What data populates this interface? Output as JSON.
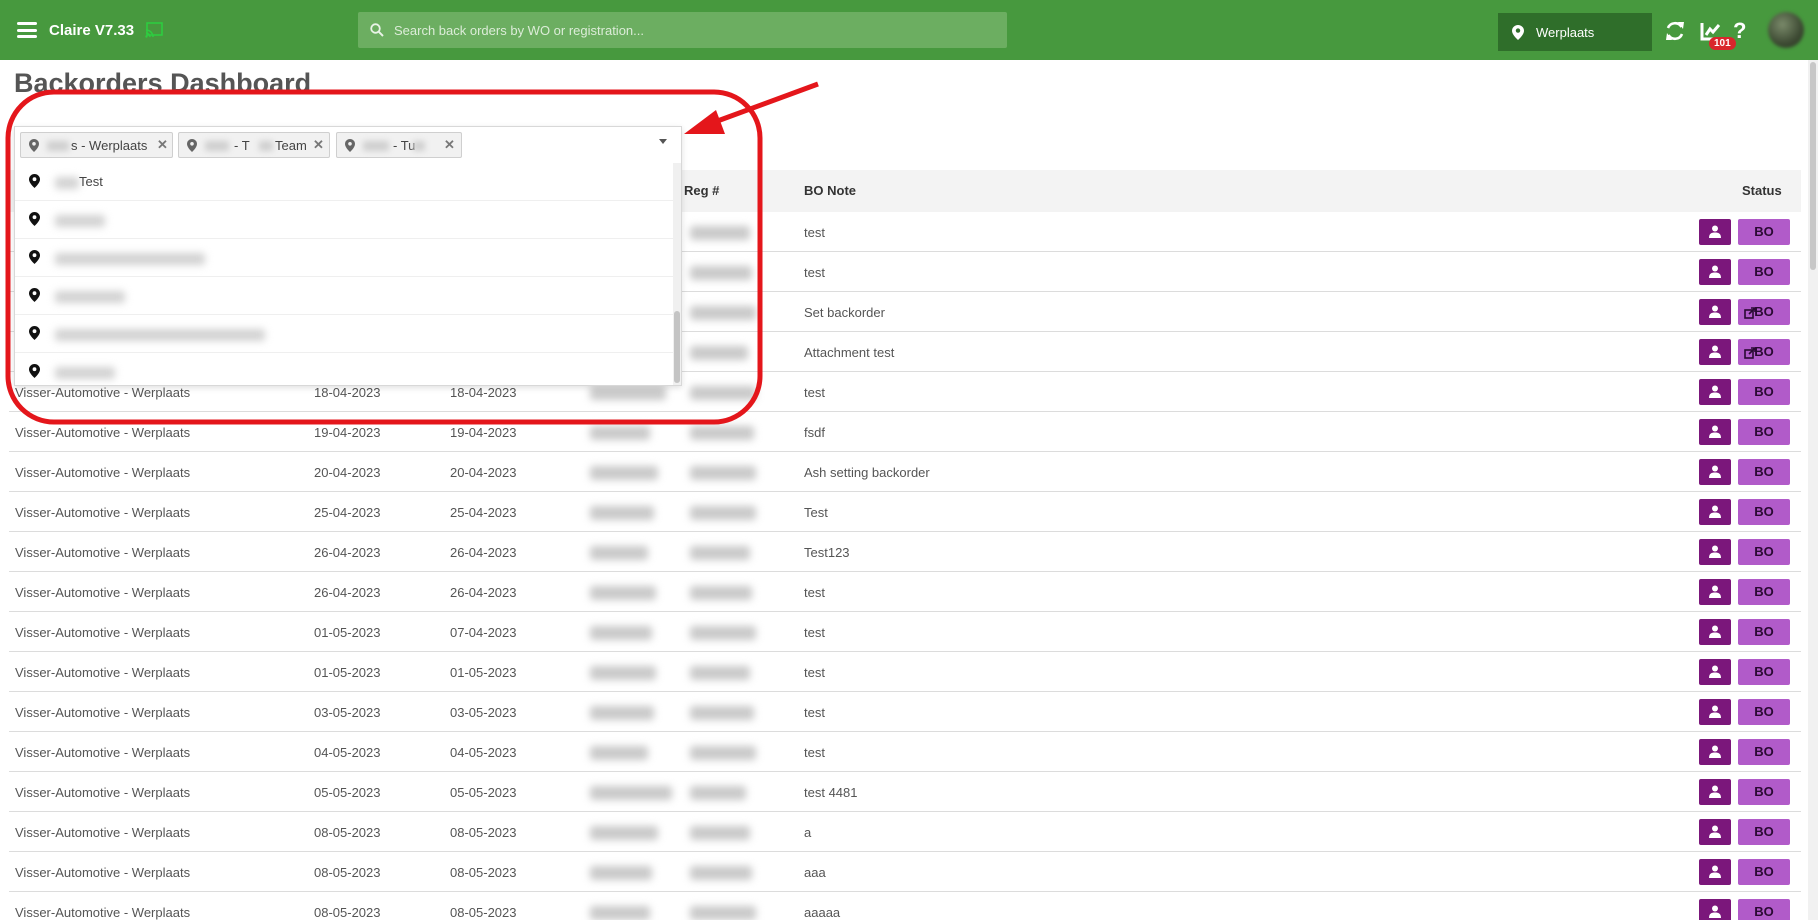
{
  "app": {
    "title": "Claire V7.33",
    "search_placeholder": "Search back orders by WO or registration...",
    "location": "Werplaats",
    "notification_count": "101",
    "help_symbol": "?"
  },
  "page": {
    "title": "Backorders Dashboard"
  },
  "filter": {
    "selected_tags": [
      {
        "text": "s - Werplaats"
      },
      {
        "text": "- T",
        "text2": "Team"
      },
      {
        "text": "- Tu"
      }
    ],
    "options": [
      {
        "label": "Test"
      },
      {
        "label": ""
      },
      {
        "label": ""
      },
      {
        "label": ""
      },
      {
        "label": ""
      },
      {
        "label": ""
      }
    ]
  },
  "table": {
    "headers": {
      "reg": "Reg #",
      "note": "BO Note",
      "status": "Status"
    },
    "status_label": "BO",
    "rows": [
      {
        "location": "",
        "date1": "",
        "date2": "",
        "note": "test",
        "external": false
      },
      {
        "location": "",
        "date1": "",
        "date2": "",
        "note": "test",
        "external": false
      },
      {
        "location": "",
        "date1": "",
        "date2": "",
        "note": "Set backorder",
        "external": true
      },
      {
        "location": "",
        "date1": "",
        "date2": "",
        "note": "Attachment test",
        "external": true
      },
      {
        "location": "Visser-Automotive - Werplaats",
        "date1": "18-04-2023",
        "date2": "18-04-2023",
        "note": "test",
        "external": false
      },
      {
        "location": "Visser-Automotive - Werplaats",
        "date1": "19-04-2023",
        "date2": "19-04-2023",
        "note": "fsdf",
        "external": false
      },
      {
        "location": "Visser-Automotive - Werplaats",
        "date1": "20-04-2023",
        "date2": "20-04-2023",
        "note": "Ash setting backorder",
        "external": false
      },
      {
        "location": "Visser-Automotive - Werplaats",
        "date1": "25-04-2023",
        "date2": "25-04-2023",
        "note": "Test",
        "external": false
      },
      {
        "location": "Visser-Automotive - Werplaats",
        "date1": "26-04-2023",
        "date2": "26-04-2023",
        "note": "Test123",
        "external": false
      },
      {
        "location": "Visser-Automotive - Werplaats",
        "date1": "26-04-2023",
        "date2": "26-04-2023",
        "note": "test",
        "external": false
      },
      {
        "location": "Visser-Automotive - Werplaats",
        "date1": "01-05-2023",
        "date2": "07-04-2023",
        "note": "test",
        "external": false
      },
      {
        "location": "Visser-Automotive - Werplaats",
        "date1": "01-05-2023",
        "date2": "01-05-2023",
        "note": "test",
        "external": false
      },
      {
        "location": "Visser-Automotive - Werplaats",
        "date1": "03-05-2023",
        "date2": "03-05-2023",
        "note": "test",
        "external": false
      },
      {
        "location": "Visser-Automotive - Werplaats",
        "date1": "04-05-2023",
        "date2": "04-05-2023",
        "note": "test",
        "external": false
      },
      {
        "location": "Visser-Automotive - Werplaats",
        "date1": "05-05-2023",
        "date2": "05-05-2023",
        "note": "test 4481",
        "external": false
      },
      {
        "location": "Visser-Automotive - Werplaats",
        "date1": "08-05-2023",
        "date2": "08-05-2023",
        "note": "a",
        "external": false
      },
      {
        "location": "Visser-Automotive - Werplaats",
        "date1": "08-05-2023",
        "date2": "08-05-2023",
        "note": "aaa",
        "external": false
      },
      {
        "location": "Visser-Automotive - Werplaats",
        "date1": "08-05-2023",
        "date2": "08-05-2023",
        "note": "aaaaa",
        "external": false
      }
    ]
  },
  "colors": {
    "topbar": "#47993e",
    "user_button": "#7b177b",
    "status_button": "#b15bc9",
    "annotation": "#e4161b"
  }
}
